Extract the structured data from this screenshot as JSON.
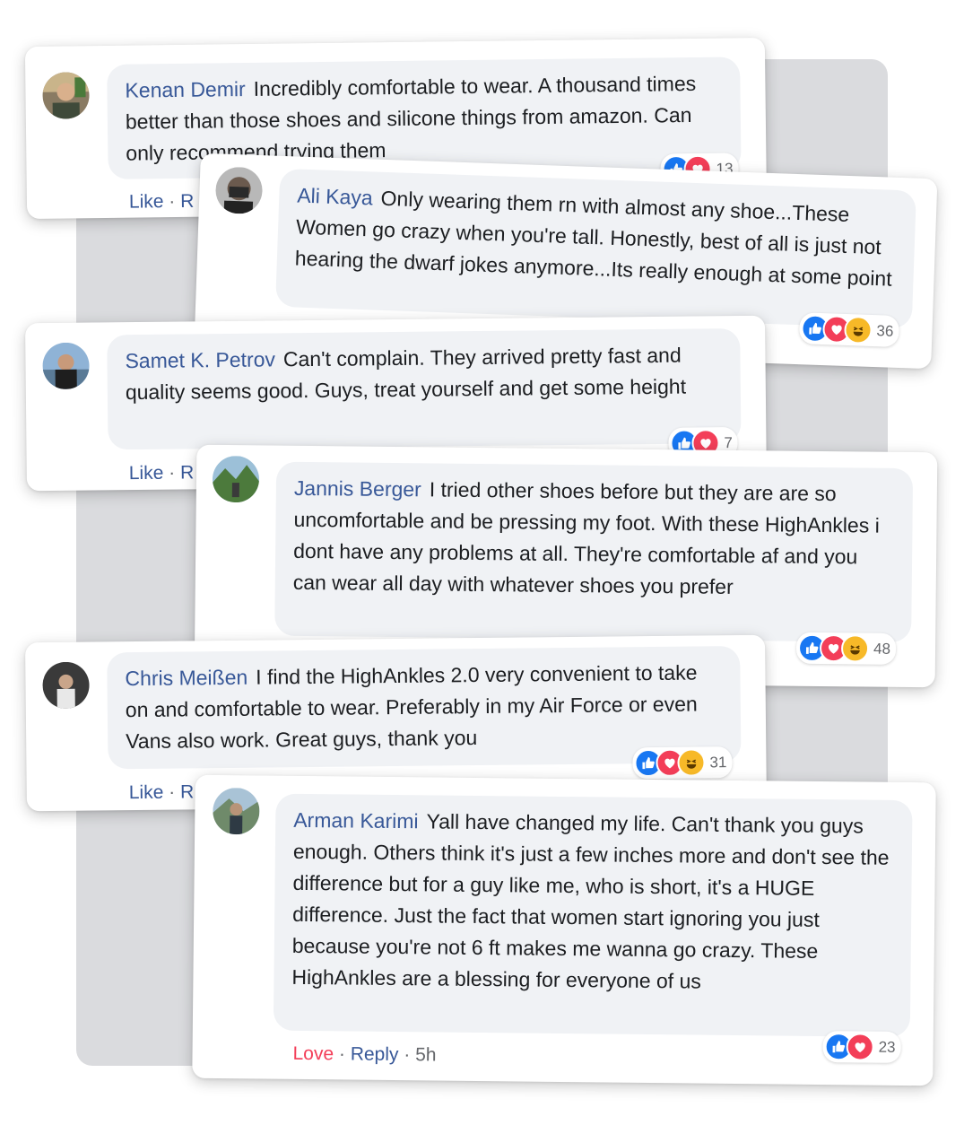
{
  "comments": [
    {
      "author": "Kenan Demir",
      "text": "Incredibly comfortable to wear. A thousand times better than those shoes and silicone things from amazon. Can only recommend trying them",
      "reaction_count": "13",
      "actions": {
        "react": "Like",
        "sep": "·",
        "reply": "R"
      }
    },
    {
      "author": "Ali Kaya",
      "text": "Only wearing them rn with almost any shoe...These Women go crazy when you're tall. Honestly, best of all is just not hearing the dwarf jokes anymore...Its really enough at some point",
      "reaction_count": "36"
    },
    {
      "author": "Samet K. Petrov",
      "text": "Can't complain. They arrived pretty fast and quality seems good. Guys, treat yourself and get some height",
      "reaction_count": "7",
      "actions": {
        "react": "Like",
        "sep": "·",
        "reply": "R"
      }
    },
    {
      "author": "Jannis Berger",
      "text": "I tried other shoes before but they are are so uncomfortable and be pressing my foot. With these HighAnkles i dont have any problems at all. They're comfortable af and you can wear all day with whatever shoes you prefer",
      "reaction_count": "48"
    },
    {
      "author": "Chris Meißen",
      "text": "I find the HighAnkles 2.0 very convenient to take on and comfortable to wear. Preferably in my Air Force or even Vans also work. Great guys, thank you",
      "reaction_count": "31",
      "actions": {
        "react": "Like",
        "sep": "·",
        "reply": "R"
      }
    },
    {
      "author": "Arman Karimi",
      "text": "Yall have changed my life. Can't thank you guys enough. Others think it's just a few inches more and don't see the difference but for a guy like me, who is short, it's a HUGE difference. Just the fact that women start ignoring you just because you're not 6 ft makes me wanna go crazy. These HighAnkles are a blessing for everyone of us",
      "reaction_count": "23",
      "actions": {
        "react": "Love",
        "sep": "·",
        "reply": "Reply",
        "sep2": "·",
        "time": "5h"
      }
    }
  ],
  "colors": {
    "author": "#385898",
    "like_blue": "#1877f2",
    "love_red": "#f33e58",
    "haha_yellow": "#f7b928",
    "bubble": "#f0f2f5",
    "backdrop": "#dadbde"
  },
  "icons": {
    "like": "thumbs-up-icon",
    "love": "heart-icon",
    "haha": "laughing-face-icon"
  }
}
